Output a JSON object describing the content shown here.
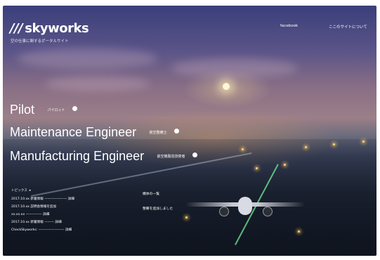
{
  "brand": {
    "slashes": "///",
    "name": "skyworks",
    "tagline": "空の仕事に関するポータルサイト"
  },
  "nav": {
    "facebook": "facebook",
    "language": "ここのサイトについて"
  },
  "jobs": [
    {
      "title": "Pilot",
      "sub": "パイロット"
    },
    {
      "title": "Maintenance Engineer",
      "sub": "航空整備士"
    },
    {
      "title": "Manufacturing Engineer",
      "sub": "航空機製造技術者"
    }
  ],
  "info": {
    "heading": "トピックス",
    "items": [
      "2017.10.xx 新着情報 ——————— 詳細",
      "2017.10.xx 説明会情報を追加",
      "xx.xx.xx ————— 詳細",
      "2017.10.xx 新着情報 ——— 詳細",
      "CheckSkyworks: ———————— 詳細"
    ]
  },
  "plane_caption": {
    "line1": "機体の一覧",
    "line2": "整備を追加しました"
  }
}
